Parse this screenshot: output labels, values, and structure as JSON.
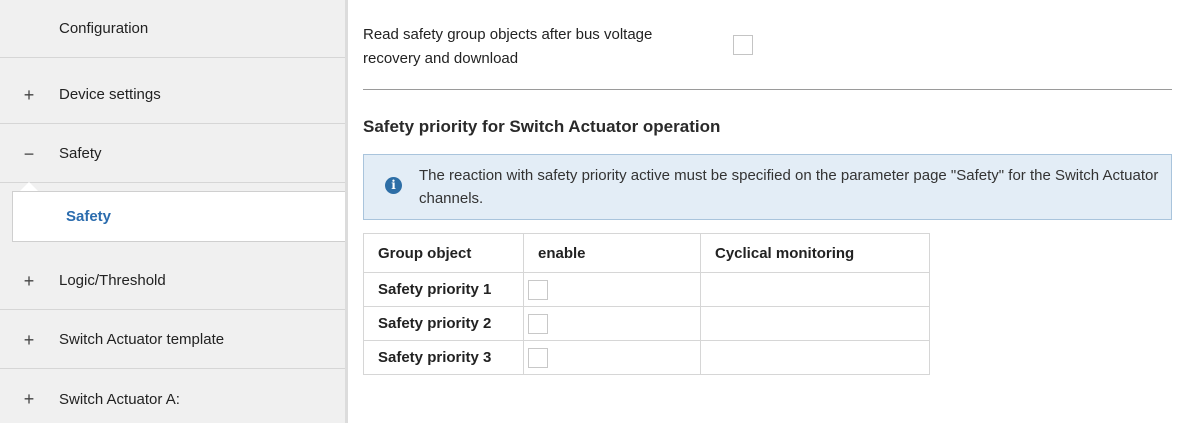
{
  "sidebar": {
    "items": [
      {
        "sign": "",
        "label": "Configuration"
      },
      {
        "sign": "+",
        "label": "Device settings"
      },
      {
        "sign": "−",
        "label": "Safety"
      },
      {
        "sign": "",
        "label": "Safety"
      },
      {
        "sign": "+",
        "label": "Logic/Threshold"
      },
      {
        "sign": "+",
        "label": "Switch Actuator template"
      },
      {
        "sign": "+",
        "label": "Switch Actuator A:"
      }
    ]
  },
  "main": {
    "read_param_label_line1": "Read safety group objects after bus voltage",
    "read_param_label_line2": "recovery and download",
    "section_title": "Safety priority for Switch Actuator operation",
    "info_icon": "i",
    "info_text": "The reaction with safety priority active must be specified on the parameter page \"Safety\" for the Switch Actuator channels.",
    "table": {
      "headers": [
        "Group object",
        "enable",
        "Cyclical monitoring"
      ],
      "rows": [
        {
          "label": "Safety priority 1"
        },
        {
          "label": "Safety priority 2"
        },
        {
          "label": "Safety priority 3"
        }
      ]
    }
  },
  "colors": {
    "sidebar_bg": "#f0f0f0",
    "active_text": "#2b6cae",
    "info_bg": "#e3edf6",
    "info_border": "#a9c4dc",
    "info_icon": "#2d6ea6"
  },
  "icons": {
    "expand": "plus-icon",
    "collapse": "minus-icon",
    "info": "info-icon"
  }
}
